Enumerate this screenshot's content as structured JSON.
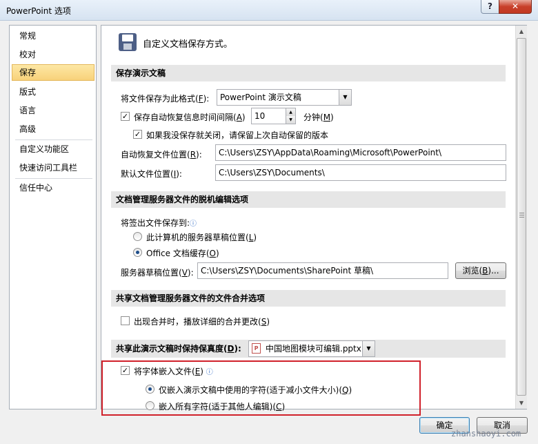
{
  "window": {
    "title": "PowerPoint 选项",
    "help_label": "?",
    "close_label": "✕"
  },
  "nav": {
    "items": [
      {
        "label": "常规"
      },
      {
        "label": "校对"
      },
      {
        "label": "保存"
      },
      {
        "label": "版式"
      },
      {
        "label": "语言"
      },
      {
        "label": "高级"
      },
      {
        "label": "自定义功能区"
      },
      {
        "label": "快速访问工具栏"
      },
      {
        "label": "信任中心"
      }
    ]
  },
  "header": {
    "text": "自定义文档保存方式。"
  },
  "section_save": {
    "title": "保存演示文稿",
    "format_label": "将文件保存为此格式(",
    "format_key": "F",
    "format_label_end": "):",
    "format_value": "PowerPoint 演示文稿",
    "autorecover_label": "保存自动恢复信息时间间隔(",
    "autorecover_key": "A",
    "autorecover_label_end": ")",
    "autorecover_checked": true,
    "autorecover_minutes": "10",
    "minutes_label": "分钟(",
    "minutes_key": "M",
    "minutes_label_end": ")",
    "keep_last_label": "如果我没保存就关闭，请保留上次自动保留的版本",
    "keep_last_checked": true,
    "autorecover_path_label": "自动恢复文件位置(",
    "autorecover_path_key": "R",
    "autorecover_path_label_end": "):",
    "autorecover_path": "C:\\Users\\ZSY\\AppData\\Roaming\\Microsoft\\PowerPoint\\",
    "default_path_label": "默认文件位置(",
    "default_path_key": "I",
    "default_path_label_end": "):",
    "default_path": "C:\\Users\\ZSY\\Documents\\"
  },
  "section_offline": {
    "title": "文档管理服务器文件的脱机编辑选项",
    "checkout_label": "将签出文件保存到:",
    "option_server_label": "此计算机的服务器草稿位置(",
    "option_server_key": "L",
    "option_server_label_end": ")",
    "option_office_label": "Office 文档缓存(",
    "option_office_key": "O",
    "option_office_label_end": ")",
    "selected": "office",
    "drafts_label": "服务器草稿位置(",
    "drafts_key": "V",
    "drafts_label_end": "):",
    "drafts_path": "C:\\Users\\ZSY\\Documents\\SharePoint 草稿\\",
    "browse_label": "浏览(",
    "browse_key": "B",
    "browse_label_end": ")..."
  },
  "section_merge": {
    "title": "共享文档管理服务器文件的文件合并选项",
    "show_merge_label": "出现合并时，播放详细的合并更改(",
    "show_merge_key": "S",
    "show_merge_label_end": ")",
    "show_merge_checked": false
  },
  "section_fidelity": {
    "title_prefix": "共享此演示文稿时保持保真度(",
    "title_key": "D",
    "title_suffix": "):",
    "file_value": "中国地图模块可编辑.pptx",
    "ppt_icon": "P",
    "embed_label": "将字体嵌入文件(",
    "embed_key": "E",
    "embed_label_end": ")",
    "embed_checked": true,
    "only_used_label": "仅嵌入演示文稿中使用的字符(适于减小文件大小)(",
    "only_used_key": "Q",
    "only_used_label_end": ")",
    "all_chars_label": "嵌入所有字符(适于其他人编辑)(",
    "all_chars_key": "C",
    "all_chars_label_end": ")",
    "selected": "only_used"
  },
  "buttons": {
    "ok_label": "确定",
    "cancel_label": "取消"
  },
  "watermark": "zhanshaoyi.com",
  "icons": {
    "info": "ⓘ",
    "check": "✓",
    "dropdown": "▼",
    "spin_up": "▲",
    "spin_down": "▼",
    "scroll_up": "▲",
    "scroll_down": "▼"
  },
  "colors": {
    "selected_nav": "#f8d27a",
    "highlight_box": "#d0202a",
    "section_bg": "#e6e6e6"
  }
}
